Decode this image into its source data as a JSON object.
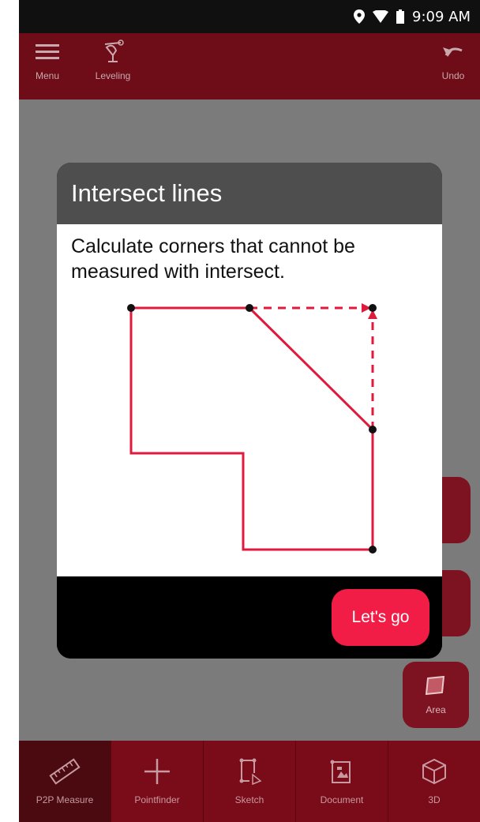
{
  "status_bar": {
    "time": "9:09 AM",
    "icons": [
      "location-icon",
      "wifi-icon",
      "battery-icon"
    ]
  },
  "app_bar": {
    "menu_label": "Menu",
    "leveling_label": "Leveling",
    "undo_label": "Undo"
  },
  "side_buttons": {
    "area_label": "Area"
  },
  "dialog": {
    "title": "Intersect lines",
    "message": "Calculate corners that cannot be measured with intersect.",
    "action_label": "Let's go"
  },
  "bottom_nav": {
    "items": [
      {
        "label": "P2P Measure",
        "icon": "ruler-icon"
      },
      {
        "label": "Pointfinder",
        "icon": "plus-icon"
      },
      {
        "label": "Sketch",
        "icon": "sketch-icon"
      },
      {
        "label": "Document",
        "icon": "document-icon"
      },
      {
        "label": "3D",
        "icon": "cube-icon"
      }
    ]
  },
  "colors": {
    "brand": "#6e0c18",
    "accent": "#f21d46",
    "diagram_line": "#e01a3c"
  }
}
